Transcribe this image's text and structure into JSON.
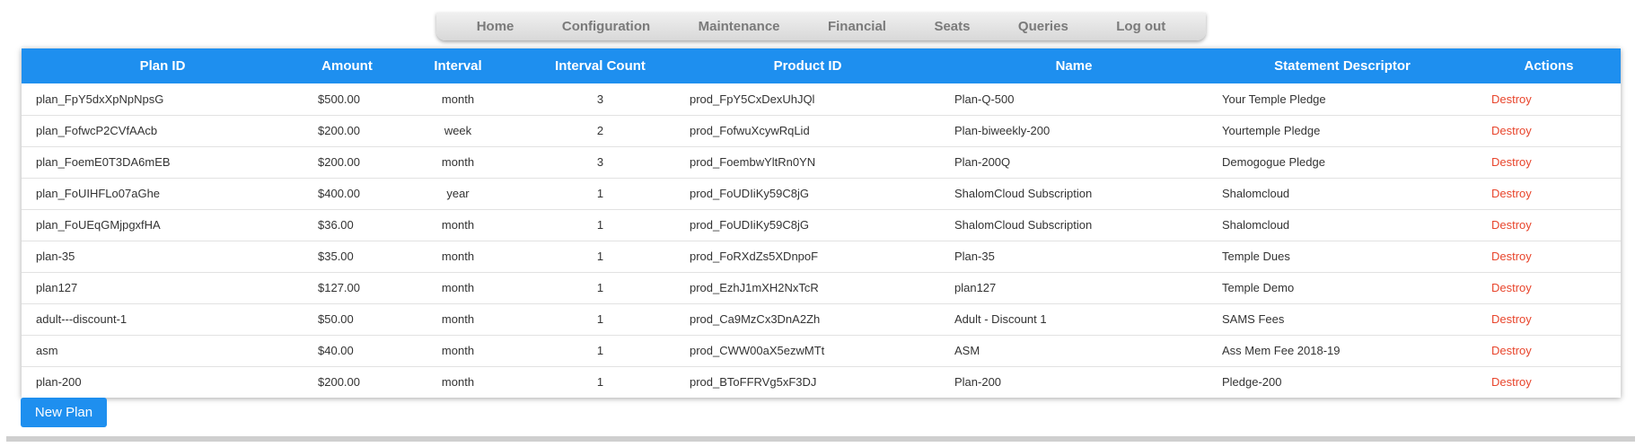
{
  "nav": {
    "items": [
      {
        "label": "Home"
      },
      {
        "label": "Configuration"
      },
      {
        "label": "Maintenance"
      },
      {
        "label": "Financial"
      },
      {
        "label": "Seats"
      },
      {
        "label": "Queries"
      },
      {
        "label": "Log out"
      }
    ]
  },
  "table": {
    "headers": [
      "Plan ID",
      "Amount",
      "Interval",
      "Interval Count",
      "Product ID",
      "Name",
      "Statement Descriptor",
      "Actions"
    ],
    "rows": [
      {
        "plan_id": "plan_FpY5dxXpNpNpsG",
        "amount": "$500.00",
        "interval": "month",
        "count": "3",
        "product_id": "prod_FpY5CxDexUhJQl",
        "name": "Plan-Q-500",
        "descriptor": "Your Temple Pledge",
        "action": "Destroy"
      },
      {
        "plan_id": "plan_FofwcP2CVfAAcb",
        "amount": "$200.00",
        "interval": "week",
        "count": "2",
        "product_id": "prod_FofwuXcywRqLid",
        "name": "Plan-biweekly-200",
        "descriptor": "Yourtemple Pledge",
        "action": "Destroy"
      },
      {
        "plan_id": "plan_FoemE0T3DA6mEB",
        "amount": "$200.00",
        "interval": "month",
        "count": "3",
        "product_id": "prod_FoembwYltRn0YN",
        "name": "Plan-200Q",
        "descriptor": "Demogogue Pledge",
        "action": "Destroy"
      },
      {
        "plan_id": "plan_FoUIHFLo07aGhe",
        "amount": "$400.00",
        "interval": "year",
        "count": "1",
        "product_id": "prod_FoUDIiKy59C8jG",
        "name": "ShalomCloud Subscription",
        "descriptor": "Shalomcloud",
        "action": "Destroy"
      },
      {
        "plan_id": "plan_FoUEqGMjpgxfHA",
        "amount": "$36.00",
        "interval": "month",
        "count": "1",
        "product_id": "prod_FoUDIiKy59C8jG",
        "name": "ShalomCloud Subscription",
        "descriptor": "Shalomcloud",
        "action": "Destroy"
      },
      {
        "plan_id": "plan-35",
        "amount": "$35.00",
        "interval": "month",
        "count": "1",
        "product_id": "prod_FoRXdZs5XDnpoF",
        "name": "Plan-35",
        "descriptor": "Temple Dues",
        "action": "Destroy"
      },
      {
        "plan_id": "plan127",
        "amount": "$127.00",
        "interval": "month",
        "count": "1",
        "product_id": "prod_EzhJ1mXH2NxTcR",
        "name": "plan127",
        "descriptor": "Temple Demo",
        "action": "Destroy"
      },
      {
        "plan_id": "adult---discount-1",
        "amount": "$50.00",
        "interval": "month",
        "count": "1",
        "product_id": "prod_Ca9MzCx3DnA2Zh",
        "name": "Adult - Discount 1",
        "descriptor": "SAMS Fees",
        "action": "Destroy"
      },
      {
        "plan_id": "asm",
        "amount": "$40.00",
        "interval": "month",
        "count": "1",
        "product_id": "prod_CWW00aX5ezwMTt",
        "name": "ASM",
        "descriptor": "Ass Mem Fee 2018-19",
        "action": "Destroy"
      },
      {
        "plan_id": "plan-200",
        "amount": "$200.00",
        "interval": "month",
        "count": "1",
        "product_id": "prod_BToFFRVg5xF3DJ",
        "name": "Plan-200",
        "descriptor": "Pledge-200",
        "action": "Destroy"
      }
    ]
  },
  "new_plan_label": "New Plan",
  "colors": {
    "header_bg": "#1e8fef",
    "destroy_link": "#e8452c",
    "button_bg": "#1e8fef"
  }
}
